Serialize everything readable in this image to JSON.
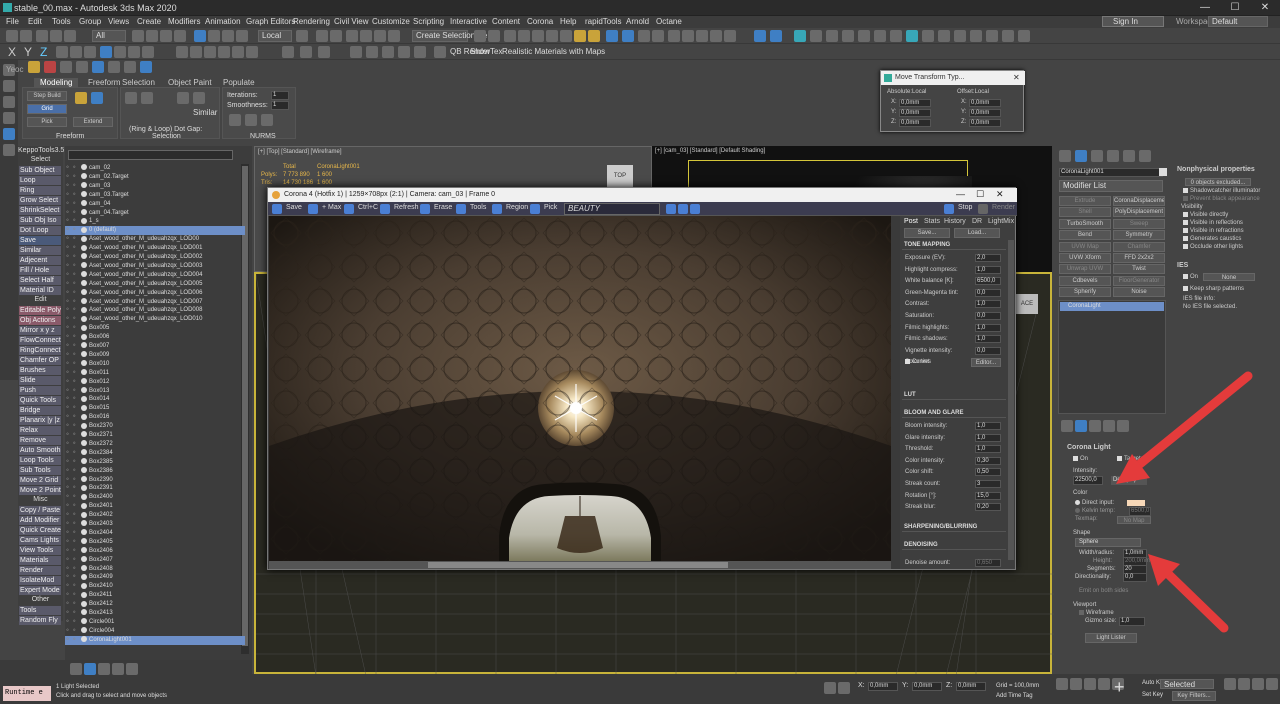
{
  "app": {
    "title": "stable_00.max - Autodesk 3ds Max 2020",
    "window_controls": [
      "—",
      "☐",
      "✕"
    ]
  },
  "menu": [
    "File",
    "Edit",
    "Tools",
    "Group",
    "Views",
    "Create",
    "Modifiers",
    "Animation",
    "Graph Editors",
    "Rendering",
    "Civil View",
    "Customize",
    "Scripting",
    "Interactive",
    "Content",
    "Corona",
    "Help",
    "rapidTools",
    "Arnold",
    "Octane"
  ],
  "account": {
    "sign_in": "Sign In",
    "workspaces_label": "Workspaces:",
    "workspace": "Default"
  },
  "toolbar": {
    "selection_filter": "All",
    "coord": "Local",
    "named_selection": "Create Selection Se",
    "qb_render": "QB Render",
    "show_tex": "ShowTex",
    "realistic": "Realistic Materials with Maps"
  },
  "ribbon": {
    "tabs": [
      "Modeling",
      "Freeform",
      "Selection",
      "Object Paint",
      "Populate"
    ],
    "panel_labels": [
      "Freeform",
      "Selection",
      "NURMS"
    ],
    "iterations_label": "Iterations:",
    "smoothness_label": "Smoothness:",
    "similar": "Similar",
    "ring_loop": "(Ring & Loop) Dot Gap:",
    "grid": "Grid",
    "pick": "Pick",
    "extend": "Extend",
    "step_build": "Step Build"
  },
  "quad": {
    "title": "KeppoTools3.5",
    "items": [
      {
        "t": "Select",
        "h": true
      },
      {
        "t": "Sub Object"
      },
      {
        "t": "Loop"
      },
      {
        "t": "Ring"
      },
      {
        "t": "Grow Select"
      },
      {
        "t": "ShrinkSelect"
      },
      {
        "t": "Sub Obj Iso"
      },
      {
        "t": "Dot Loop"
      },
      {
        "t": "Save",
        "c": "bl"
      },
      {
        "t": "Similar"
      },
      {
        "t": "Adjecent"
      },
      {
        "t": "Fill / Hole"
      },
      {
        "t": "Select Half"
      },
      {
        "t": "Material ID"
      },
      {
        "t": "Edit",
        "h": true
      },
      {
        "t": "Editable Poly",
        "c": "pk"
      },
      {
        "t": "Obj Actions",
        "c": "pk"
      },
      {
        "t": "Mirror  x y z"
      },
      {
        "t": "FlowConnect"
      },
      {
        "t": "RingConnect"
      },
      {
        "t": "Chamfer OP"
      },
      {
        "t": "Brushes"
      },
      {
        "t": "Slide"
      },
      {
        "t": "Push"
      },
      {
        "t": "Quick Tools"
      },
      {
        "t": "Bridge"
      },
      {
        "t": "Planarix |y |z"
      },
      {
        "t": "Relax"
      },
      {
        "t": "Remove"
      },
      {
        "t": "Auto Smooth"
      },
      {
        "t": "Loop Tools"
      },
      {
        "t": "Sub Tools"
      },
      {
        "t": "Move 2 Grid"
      },
      {
        "t": "Move 2 Point"
      },
      {
        "t": "Misc",
        "h": true
      },
      {
        "t": "Copy / Paste"
      },
      {
        "t": "Add Modifier"
      },
      {
        "t": "Quick Create"
      },
      {
        "t": "Cams Lights"
      },
      {
        "t": "View Tools"
      },
      {
        "t": "Materials"
      },
      {
        "t": "Render"
      },
      {
        "t": "IsolateMod"
      },
      {
        "t": "Expert Mode"
      },
      {
        "t": "Other",
        "h": true
      },
      {
        "t": "Tools"
      },
      {
        "t": "Random Fly"
      }
    ]
  },
  "scene": {
    "rows": [
      {
        "t": "cam_02"
      },
      {
        "t": "cam_02.Target"
      },
      {
        "t": "cam_03"
      },
      {
        "t": "cam_03.Target"
      },
      {
        "t": "cam_04"
      },
      {
        "t": "cam_04.Target"
      },
      {
        "t": "1_s"
      },
      {
        "t": "0 (default)",
        "sel": true
      },
      {
        "t": "Aset_wood_other_M_udeuahzqx_LOD00"
      },
      {
        "t": "Aset_wood_other_M_udeuahzqx_LOD001"
      },
      {
        "t": "Aset_wood_other_M_udeuahzqx_LOD002"
      },
      {
        "t": "Aset_wood_other_M_udeuahzqx_LOD003"
      },
      {
        "t": "Aset_wood_other_M_udeuahzqx_LOD004"
      },
      {
        "t": "Aset_wood_other_M_udeuahzqx_LOD005"
      },
      {
        "t": "Aset_wood_other_M_udeuahzqx_LOD006"
      },
      {
        "t": "Aset_wood_other_M_udeuahzqx_LOD007"
      },
      {
        "t": "Aset_wood_other_M_udeuahzqx_LOD008"
      },
      {
        "t": "Aset_wood_other_M_udeuahzqx_LOD010"
      },
      {
        "t": "Box005"
      },
      {
        "t": "Box006"
      },
      {
        "t": "Box007"
      },
      {
        "t": "Box009"
      },
      {
        "t": "Box010"
      },
      {
        "t": "Box011"
      },
      {
        "t": "Box012"
      },
      {
        "t": "Box013"
      },
      {
        "t": "Box014"
      },
      {
        "t": "Box015"
      },
      {
        "t": "Box016"
      },
      {
        "t": "Box2370"
      },
      {
        "t": "Box2371"
      },
      {
        "t": "Box2372"
      },
      {
        "t": "Box2384"
      },
      {
        "t": "Box2385"
      },
      {
        "t": "Box2386"
      },
      {
        "t": "Box2390"
      },
      {
        "t": "Box2391"
      },
      {
        "t": "Box2400"
      },
      {
        "t": "Box2401"
      },
      {
        "t": "Box2402"
      },
      {
        "t": "Box2403"
      },
      {
        "t": "Box2404"
      },
      {
        "t": "Box2405"
      },
      {
        "t": "Box2406"
      },
      {
        "t": "Box2407"
      },
      {
        "t": "Box2408"
      },
      {
        "t": "Box2409"
      },
      {
        "t": "Box2410"
      },
      {
        "t": "Box2411"
      },
      {
        "t": "Box2412"
      },
      {
        "t": "Box2413"
      },
      {
        "t": "Circle001"
      },
      {
        "t": "Circle004"
      },
      {
        "t": "CoronaLight001",
        "sel": true
      }
    ]
  },
  "status": {
    "runtime": "Runtime e",
    "selected": "1 Light Selected",
    "hint": "Click and drag to select and move objects",
    "x": "0,0mm",
    "y": "0,0mm",
    "z": "0,0mm",
    "grid": "Grid = 100,0mm",
    "add_time_tag": "Add Time Tag",
    "auto_key": "Auto Key",
    "set_key": "Set Key",
    "selected_dd": "Selected",
    "key_filters": "Key Filters..."
  },
  "viewports": {
    "top_label": "[+] [Top] [Standard] [Wireframe]",
    "top_stats": {
      "total": "Total",
      "obj": "CoronaLight001",
      "polys_l": "Polys:",
      "polys": "7 773 890",
      "polys2": "1 600",
      "tris_l": "Tris:",
      "tris": "14 730 186",
      "tris2": "1 600"
    },
    "top_cube": "TOP",
    "cam_label": "[+] [cam_03] [Standard] [Default Shading]"
  },
  "vfb": {
    "title": "Corona 4 (Hotfix 1) | 1259×708px (2:1) | Camera: cam_03 | Frame 0",
    "tools": [
      "Save",
      "+ Max",
      "Ctrl+C",
      "Refresh",
      "Erase",
      "Tools",
      "Region",
      "Pick"
    ],
    "channel": "BEAUTY",
    "stop": "Stop",
    "render": "Render",
    "panel_tabs": [
      "Post",
      "Stats",
      "History",
      "DR",
      "LightMix"
    ],
    "save": "Save...",
    "load": "Load...",
    "sections": {
      "tone": "TONE MAPPING",
      "lut": "LUT",
      "bloom": "BLOOM AND GLARE",
      "sharp": "SHARPENING/BLURRING",
      "denoise": "DENOISING"
    },
    "tone": [
      {
        "l": "Exposure (EV):",
        "v": "2,0"
      },
      {
        "l": "Highlight compress:",
        "v": "1,0"
      },
      {
        "l": "White balance [K]:",
        "v": "6500,0"
      },
      {
        "l": "Green-Magenta tint:",
        "v": "0,0"
      },
      {
        "l": "Contrast:",
        "v": "1,0"
      },
      {
        "l": "Saturation:",
        "v": "0,0"
      },
      {
        "l": "Filmic highlights:",
        "v": "1,0"
      },
      {
        "l": "Filmic shadows:",
        "v": "1,0"
      },
      {
        "l": "Vignette intensity:",
        "v": "0,0"
      },
      {
        "l": "Color tint:",
        "v": ""
      }
    ],
    "curves": "Curves",
    "editor": "Editor...",
    "bloom": [
      {
        "l": "Bloom intensity:",
        "v": "1,0"
      },
      {
        "l": "Glare intensity:",
        "v": "1,0"
      },
      {
        "l": "Threshold:",
        "v": "1,0"
      },
      {
        "l": "Color intensity:",
        "v": "0,30"
      },
      {
        "l": "Color shift:",
        "v": "0,50"
      },
      {
        "l": "Streak count:",
        "v": "3"
      },
      {
        "l": "Rotation [°]:",
        "v": "15,0"
      },
      {
        "l": "Streak blur:",
        "v": "0,20"
      }
    ],
    "denoise_amount_l": "Denoise amount:",
    "denoise_amount": "0,650"
  },
  "movewin": {
    "title": "Move Transform Typ...",
    "abs": "Absolute:Local",
    "off": "Offset:Local",
    "abs_vals": [
      {
        "l": "X:",
        "v": "0,0mm"
      },
      {
        "l": "Y:",
        "v": "0,0mm"
      },
      {
        "l": "Z:",
        "v": "0,0mm"
      }
    ],
    "off_vals": [
      {
        "l": "X:",
        "v": "0,0mm"
      },
      {
        "l": "Y:",
        "v": "0,0mm"
      },
      {
        "l": "Z:",
        "v": "0,0mm"
      }
    ]
  },
  "cmd": {
    "object_name": "CoronaLight001",
    "modifier_list": "Modifier List",
    "mods": [
      [
        "Extrude",
        "CoronaDisplacementMo"
      ],
      [
        "Shell",
        "PolyDisplacement"
      ],
      [
        "TurboSmooth",
        "Sweep"
      ],
      [
        "Bend",
        "Symmetry"
      ],
      [
        "UVW Map",
        "Chamfer"
      ],
      [
        "UVW Xform",
        "FFD 2x2x2"
      ],
      [
        "Unwrap UVW",
        "Twist"
      ],
      [
        "Cdbevels",
        "FloorGenerator"
      ],
      [
        "Spherify",
        "Noise"
      ]
    ],
    "stack_item": "CoronaLight",
    "np_title": "Nonphysical properties",
    "np_excluded": "0 objects excluded...",
    "np_items": [
      "Shadowcatcher illuminator",
      "Prevent black appearance"
    ],
    "vis_title": "Visibility",
    "vis_items": [
      "Visible directly",
      "Visible in reflections",
      "Visible in refractions",
      "Generates caustics",
      "Occlude other lights"
    ],
    "ies_title": "IES",
    "ies_on": "On",
    "ies_none": "None",
    "ies_keep": "Keep sharp patterns",
    "ies_file_l": "IES file info:",
    "ies_file": "No IES file selected.",
    "cl_title": "Corona Light",
    "on": "On",
    "targeted": "Targeted",
    "intensity_l": "Intensity:",
    "intensity": "22500,0",
    "intensity_unit": "Def. (^2)",
    "color_l": "Color",
    "direct_input": "Direct input:",
    "kelvin": "Kelvin temp:",
    "kelvin_v": "6500,0",
    "texmap": "Texmap:",
    "no_map": "No Map",
    "shape_l": "Shape",
    "shape": "Sphere",
    "width_l": "Width/radius:",
    "width": "1,0mm",
    "height_l": "Height:",
    "height": "200,0mm",
    "segments_l": "Segments:",
    "segments": "20",
    "direct_l": "Directionality:",
    "direct": "0,0",
    "emit_both": "Emit on both sides",
    "viewport_l": "Viewport",
    "wireframe": "Wireframe",
    "gizmo_l": "Gizmo size:",
    "gizmo": "1,0",
    "lister": "Light Lister"
  },
  "colors": {
    "accent": "#6d8fc8",
    "arrow": "#e43b3b",
    "viewport_border": "#c8b43a"
  }
}
